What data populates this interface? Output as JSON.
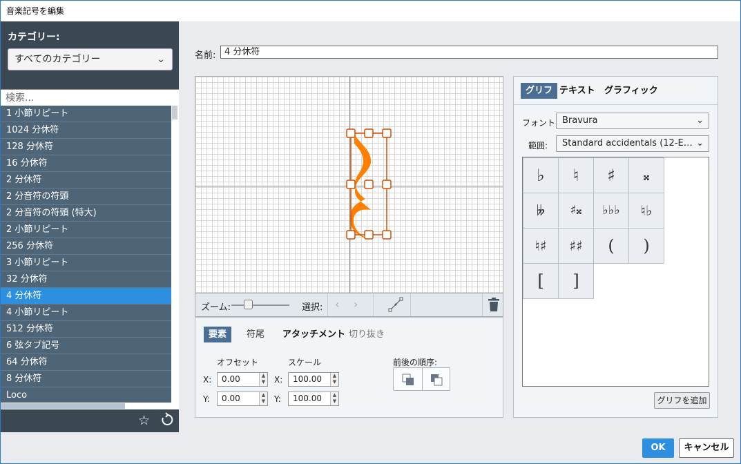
{
  "window": {
    "title": "音楽記号を編集"
  },
  "left": {
    "category_label": "カテゴリー:",
    "category_select": "すべてのカテゴリー",
    "search_placeholder": "検索...",
    "items": [
      "1 小節リピート",
      "1024 分休符",
      "128 分休符",
      "16 分休符",
      "2 分休符",
      "2 分音符の符頭",
      "2 分音符の符頭 (特大)",
      "2 小節リピート",
      "256 分休符",
      "3 小節リピート",
      "32 分休符",
      "4 分休符",
      "4 小節リピート",
      "512 分休符",
      "6 弦タブ記号",
      "64 分休符",
      "8 分休符",
      "Loco"
    ],
    "selected_index": 11
  },
  "main": {
    "name_label": "名前:",
    "name_value": "4 分休符",
    "zoom_label": "ズーム:",
    "select_label": "選択:",
    "zoom_level": 0.3
  },
  "props": {
    "tabs": [
      "要素",
      "符尾",
      "アタッチメント",
      "切り抜き"
    ],
    "offset_label": "オフセット",
    "scale_label": "スケール",
    "order_label": "前後の順序:",
    "x_label": "X:",
    "y_label": "Y:",
    "offset_x": "0.00",
    "offset_y": "0.00",
    "scale_x": "100.00",
    "scale_y": "100.00"
  },
  "right": {
    "tabs": [
      "グリフ",
      "テキスト",
      "グラフィック"
    ],
    "font_label": "フォント:",
    "font_value": "Bravura",
    "range_label": "範囲:",
    "range_value": "Standard accidentals (12-E…",
    "glyphs": [
      "♭",
      "♮",
      "♯",
      "𝄪",
      "𝄫",
      "♯𝄪",
      "♭♭♭",
      "♮♭",
      "♮♯",
      "♯♯",
      "(",
      ")",
      "[",
      "]"
    ],
    "add_glyph": "グリフを追加"
  },
  "footer": {
    "ok": "OK",
    "cancel": "キャンセル"
  },
  "colors": {
    "accent": "#2d8fe0",
    "glyph_fill": "#ff7f00",
    "handle": "#d64b00",
    "sidebar": "#3c4754"
  }
}
